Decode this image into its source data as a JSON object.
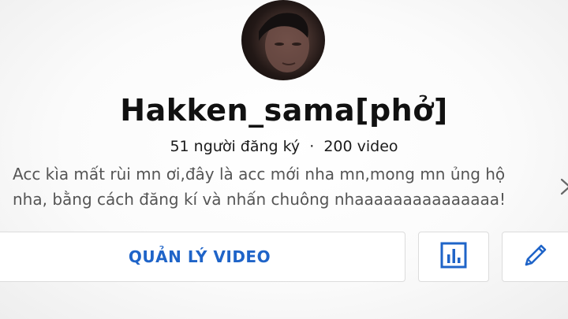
{
  "channel": {
    "name": "Hakken_sama[phở]",
    "subscribers": "51 người đăng ký",
    "separator": "·",
    "videos": "200 video",
    "description": "Acc kìa mất rùi mn ơi,đây là acc mới nha mn,mong mn ủng hộ nha, bằng cách đăng kí và nhấn chuông nhaaaaaaaaaaaaaaa!"
  },
  "actions": {
    "manage_videos_label": "QUẢN LÝ VIDEO",
    "analytics_icon": "bar-chart-icon",
    "edit_icon": "pencil-icon"
  },
  "colors": {
    "accent": "#1f64c8",
    "text": "#111111",
    "muted": "#555555"
  }
}
